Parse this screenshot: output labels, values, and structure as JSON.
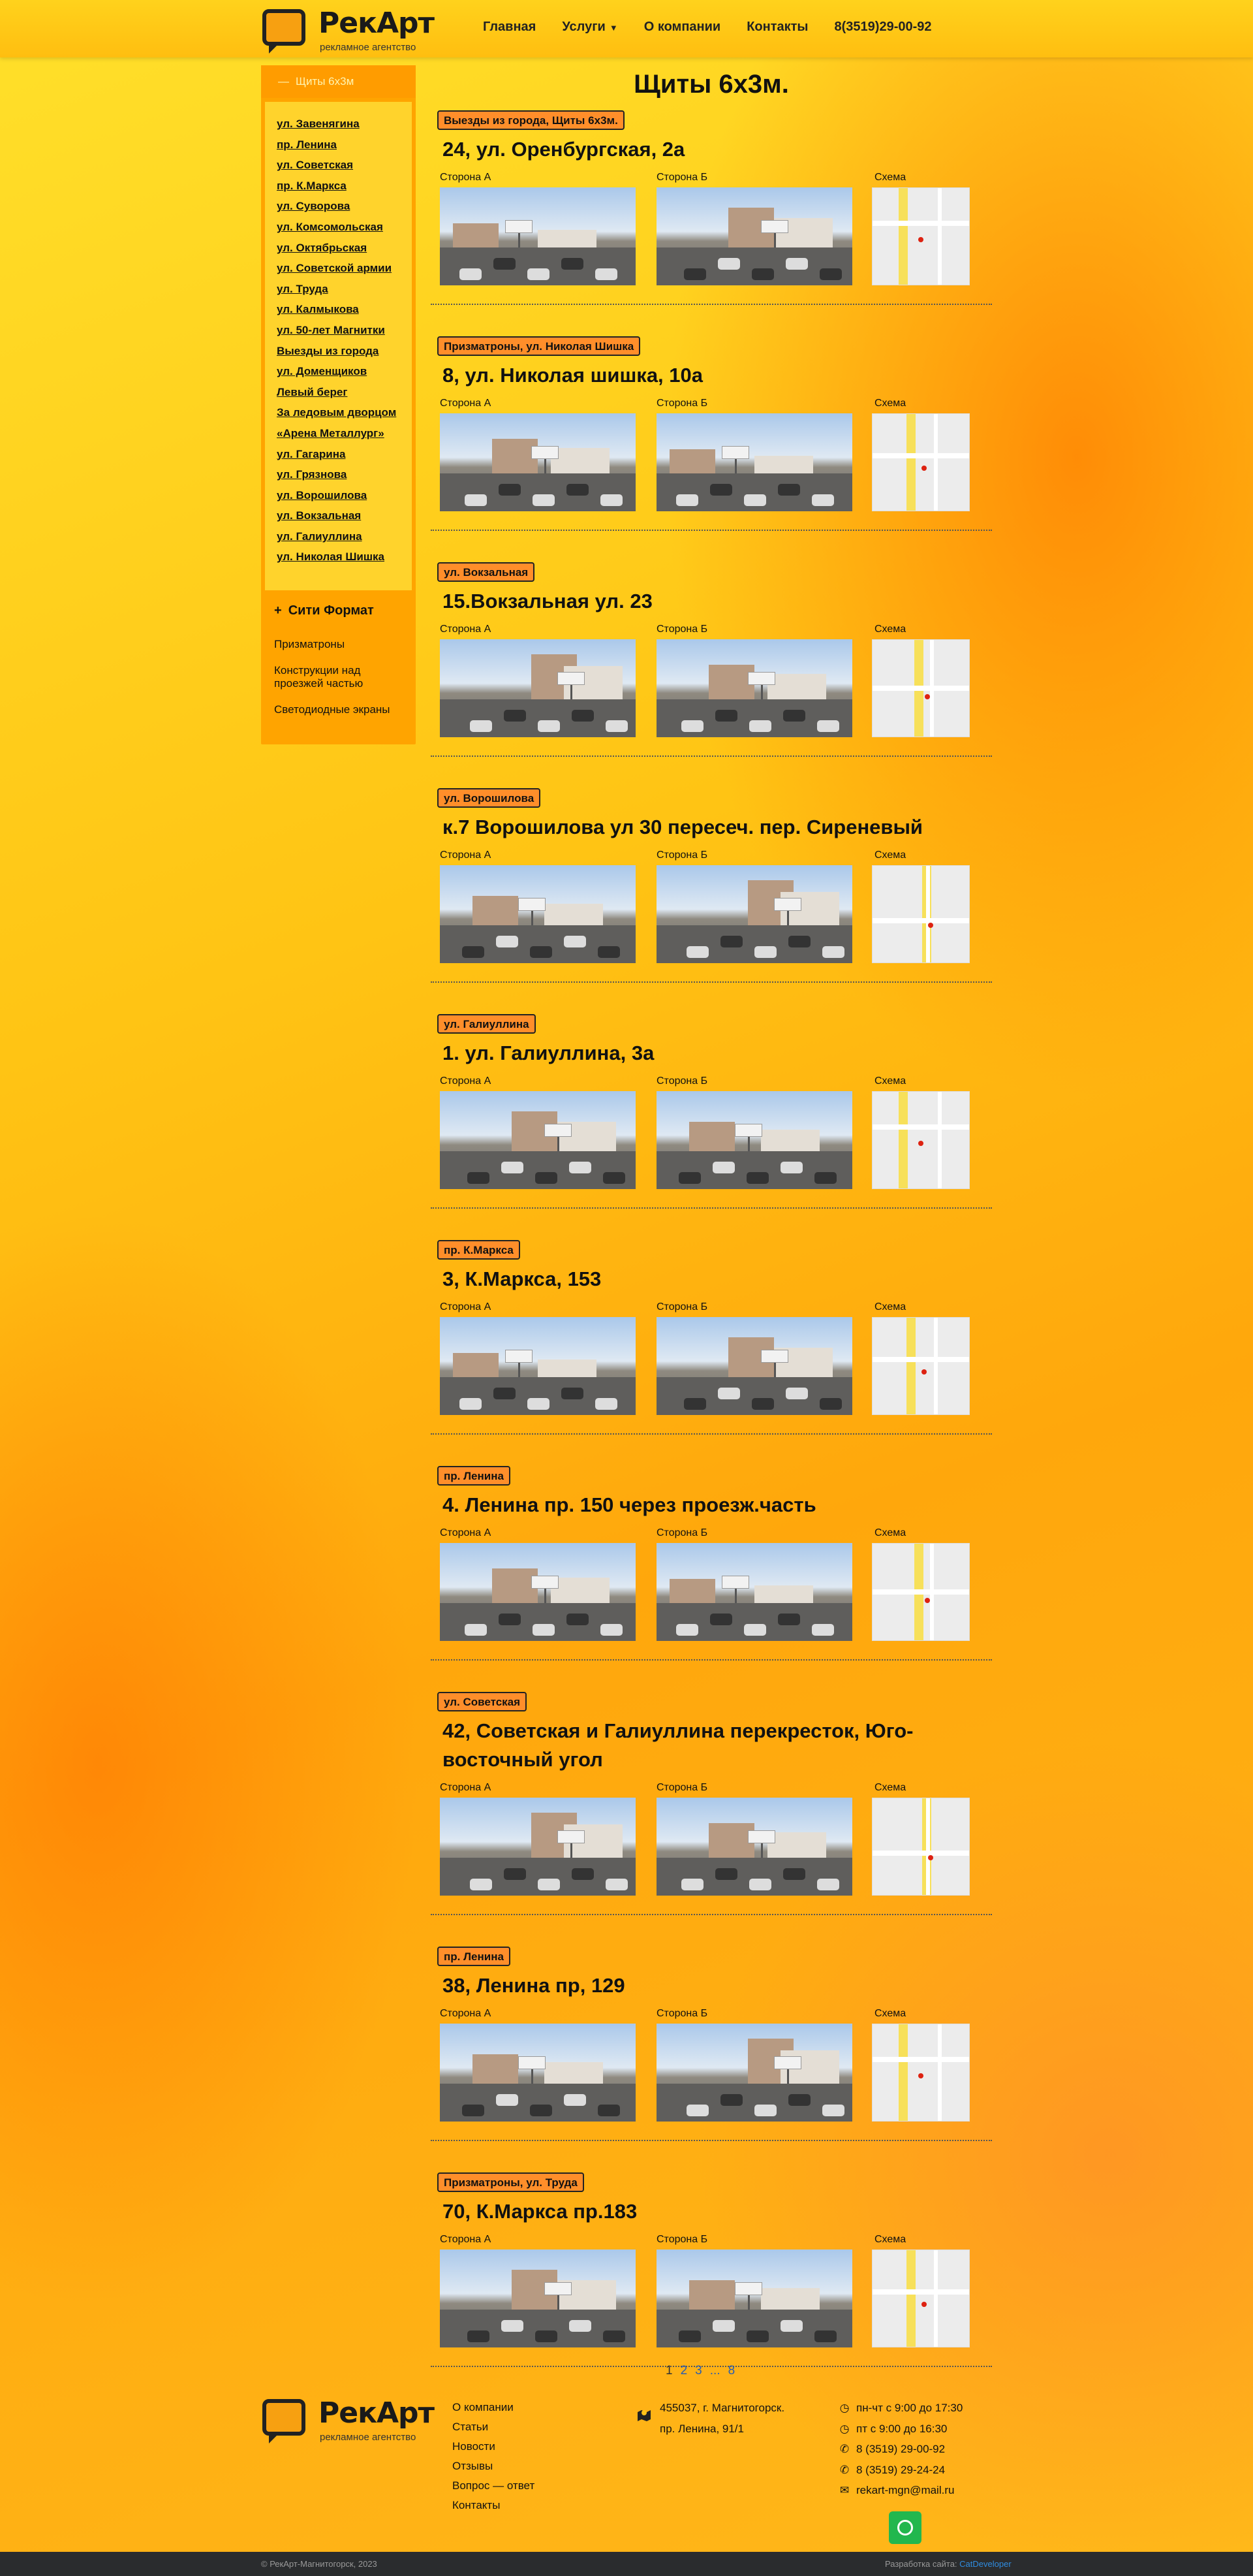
{
  "header": {
    "logo_text": "РекАрт",
    "logo_sub": "рекламное агентство",
    "nav": [
      "Главная",
      "Услуги",
      "О компании",
      "Контакты",
      "8(3519)29-00-92"
    ]
  },
  "sidebar": {
    "head": "Щиты 6х3м",
    "items": [
      "ул. Завенягина",
      "пр. Ленина",
      "ул. Советская",
      "пр. К.Маркса",
      "ул. Суворова",
      "ул. Комсомольская",
      "ул. Октябрьская",
      "ул. Советской армии",
      "ул. Труда",
      "ул. Калмыкова",
      "ул. 50-лет Магнитки",
      "Выезды из города",
      "ул. Доменщиков",
      "Левый берег",
      "За ледовым дворцом",
      "«Арена Металлург»",
      "ул. Гагарина",
      "ул. Грязнова",
      "ул. Ворошилова",
      "ул. Вокзальная",
      "ул. Галиуллина",
      "ул. Николая Шишка"
    ],
    "section": "Сити Формат",
    "section_icon": "plus-icon",
    "sub_items": [
      "Призматроны",
      "Конструкции над проезжей частью",
      "Светодиодные экраны"
    ]
  },
  "main": {
    "title": "Щиты 6х3м.",
    "side_a": "Сторона А",
    "side_b": "Сторона Б",
    "scheme": "Схема",
    "cards": [
      {
        "badge": "Выезды из города, Щиты 6х3м.",
        "title": "24, ул. Оренбургская, 2а"
      },
      {
        "badge": "Призматроны, ул. Николая Шишка",
        "title": "8, ул. Николая шишка, 10а"
      },
      {
        "badge": "ул. Вокзальная",
        "title": "15.Вокзальная ул. 23"
      },
      {
        "badge": "ул. Ворошилова",
        "title": "к.7 Ворошилова ул 30 пересеч. пер. Сиреневый"
      },
      {
        "badge": "ул. Галиуллина",
        "title": "1. ул. Галиуллина, 3а"
      },
      {
        "badge": "пр. К.Маркса",
        "title": "3, К.Маркса, 153"
      },
      {
        "badge": "пр. Ленина",
        "title": "4. Ленина пр. 150 через проезж.часть"
      },
      {
        "badge": "ул. Советская",
        "title": "42, Советская и Галиуллина перекресток, Юго-восточный угол"
      },
      {
        "badge": "пр. Ленина",
        "title": "38, Ленина пр, 129"
      },
      {
        "badge": "Призматроны, ул. Труда",
        "title": "70, К.Маркса пр.183"
      }
    ]
  },
  "pagination": {
    "pages": [
      "1",
      "2",
      "3",
      "...",
      "8"
    ],
    "current": "1"
  },
  "footer": {
    "logo_text": "РекАрт",
    "logo_sub": "рекламное агентство",
    "nav": [
      "О компании",
      "Статьи",
      "Новости",
      "Отзывы",
      "Вопрос — ответ",
      "Контакты"
    ],
    "address_line1": "455037, г. Магнитогорск.",
    "address_line2": "пр. Ленина, 91/1",
    "hours1": "пн-чт с 9:00 до 17:30",
    "hours2": "пт с 9:00 до 16:30",
    "phone1": "8 (3519) 29-00-92",
    "phone2": "8 (3519) 29-24-24",
    "email": "rekart-mgn@mail.ru",
    "copyright": "© РекАрт-Магнитогорск, 2023",
    "dev_label": "Разработка сайта:",
    "dev_name": "CatDeveloper"
  },
  "colors": {
    "accent": "#ffa400",
    "badge": "#ff8e2a",
    "link": "#2a5db0",
    "whatsapp": "#22b74e"
  }
}
